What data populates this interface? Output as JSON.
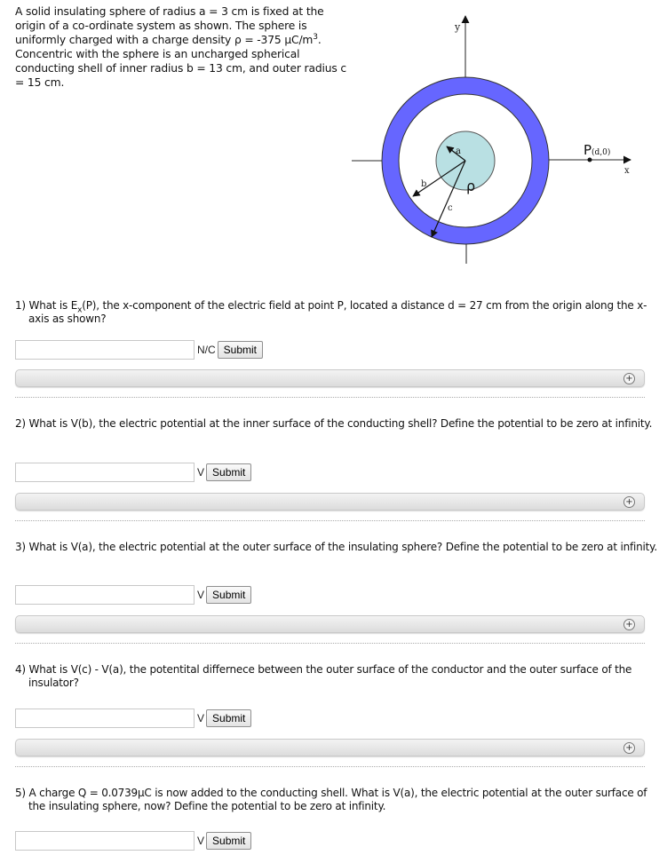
{
  "intro": {
    "line1": "A solid insulating sphere of radius a = 3 cm is fixed at the origin of a co-ordinate system as shown. The sphere is uniformly charged with a charge density ρ = -375 μC/m",
    "sup": "3",
    "line2": ". Concentric with the sphere is an uncharged spherical conducting shell of inner radius b = 13 cm, and outer radius c = 15 cm."
  },
  "diagram": {
    "y_label": "y",
    "x_label": "x",
    "point_label": "P",
    "point_coords": "(d,0)",
    "label_a": "a",
    "label_b": "b",
    "label_c": "c",
    "label_rho": "ρ",
    "colors": {
      "shell": "#6666ff",
      "sphere": "#b9e0e3",
      "axis": "#555555"
    }
  },
  "questions": [
    {
      "number": "1)",
      "text_before": "What is E",
      "sub": "x",
      "text_after": "(P), the x-component of the electric field at point P, located a distance d = 27 cm from the origin along the x-axis as shown?",
      "answer_value": "",
      "unit": "N/C",
      "submit_label": "Submit"
    },
    {
      "number": "2)",
      "text": "What is V(b), the electric potential at the inner surface of the conducting shell? Define the potential to be zero at infinity.",
      "answer_value": "",
      "unit": "V",
      "submit_label": "Submit"
    },
    {
      "number": "3)",
      "text": "What is V(a), the electric potential at the outer surface of the insulating sphere? Define the potential to be zero at infinity.",
      "answer_value": "",
      "unit": "V",
      "submit_label": "Submit"
    },
    {
      "number": "4)",
      "text": "What is V(c) - V(a), the potentital differnece between the outer surface of the conductor and the outer surface of the insulator?",
      "answer_value": "",
      "unit": "V",
      "submit_label": "Submit"
    },
    {
      "number": "5)",
      "text": "A charge Q = 0.0739μC is now added to the conducting shell. What is V(a), the electric potential at the outer surface of the insulating sphere, now? Define the potential to be zero at infinity.",
      "answer_value": "",
      "unit": "V",
      "submit_label": "Submit"
    }
  ],
  "hint_icon": "+"
}
